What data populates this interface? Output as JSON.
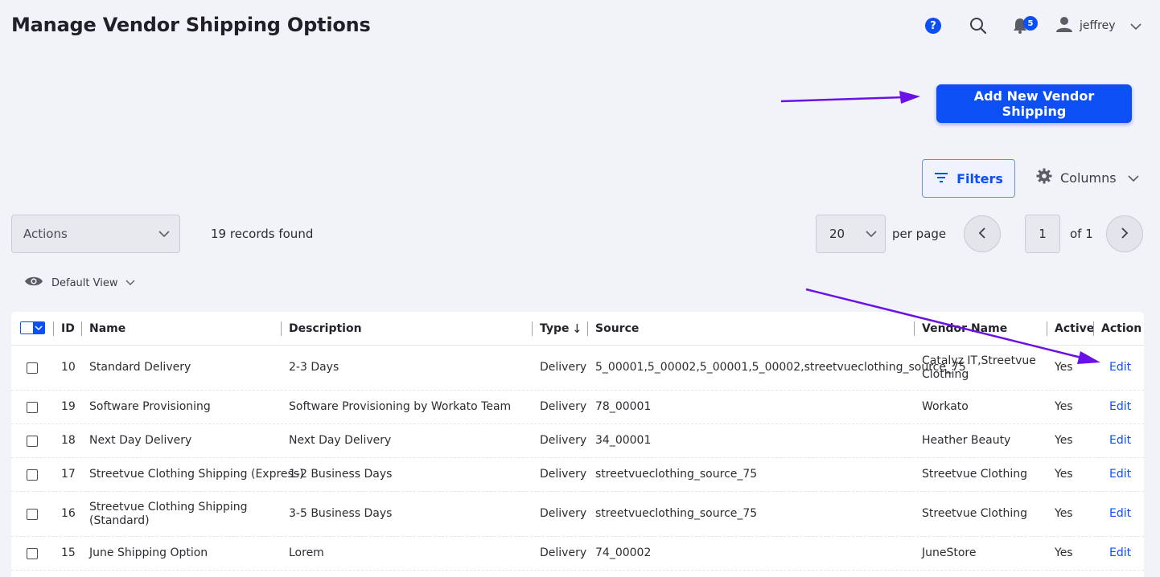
{
  "header": {
    "title": "Manage Vendor Shipping Options",
    "help_icon": "question-circle-icon",
    "help_glyph": "?",
    "search_icon": "search-icon",
    "bell_icon": "bell-icon",
    "notification_count": "5",
    "user_icon": "user-icon",
    "user_name": "jeffrey"
  },
  "toolbar": {
    "add_button_label": "Add New Vendor Shipping",
    "filters_label": "Filters",
    "columns_label": "Columns",
    "actions_label": "Actions",
    "records_found": "19 records found",
    "per_page_value": "20",
    "per_page_label": "per page",
    "current_page": "1",
    "page_total_label": "of 1",
    "view_label": "Default View"
  },
  "table": {
    "columns": [
      "ID",
      "Name",
      "Description",
      "Type",
      "Source",
      "Vendor Name",
      "Active",
      "Action"
    ],
    "sort_indicator": "↓",
    "rows": [
      {
        "id": "10",
        "name": "Standard Delivery",
        "description": "2-3 Days",
        "type": "Delivery",
        "source": "5_00001,5_00002,5_00001,5_00002,streetvueclothing_source_75",
        "vendor": "Catalyz IT,Streetvue Clothing",
        "active": "Yes",
        "action": "Edit"
      },
      {
        "id": "19",
        "name": "Software Provisioning",
        "description": "Software Provisioning by Workato Team",
        "type": "Delivery",
        "source": "78_00001",
        "vendor": "Workato",
        "active": "Yes",
        "action": "Edit"
      },
      {
        "id": "18",
        "name": "Next Day Delivery",
        "description": "Next Day Delivery",
        "type": "Delivery",
        "source": "34_00001",
        "vendor": "Heather Beauty",
        "active": "Yes",
        "action": "Edit"
      },
      {
        "id": "17",
        "name": "Streetvue Clothing Shipping (Express)",
        "description": "1-2 Business Days",
        "type": "Delivery",
        "source": "streetvueclothing_source_75",
        "vendor": "Streetvue Clothing",
        "active": "Yes",
        "action": "Edit"
      },
      {
        "id": "16",
        "name": "Streetvue Clothing Shipping (Standard)",
        "description": "3-5 Business Days",
        "type": "Delivery",
        "source": "streetvueclothing_source_75",
        "vendor": "Streetvue Clothing",
        "active": "Yes",
        "action": "Edit"
      },
      {
        "id": "15",
        "name": "June Shipping Option",
        "description": "Lorem",
        "type": "Delivery",
        "source": "74_00002",
        "vendor": "JuneStore",
        "active": "Yes",
        "action": "Edit"
      }
    ]
  },
  "colors": {
    "accent": "#0b4ff5",
    "annotation_arrow": "#6a11e8",
    "background": "#f1f3f8"
  }
}
